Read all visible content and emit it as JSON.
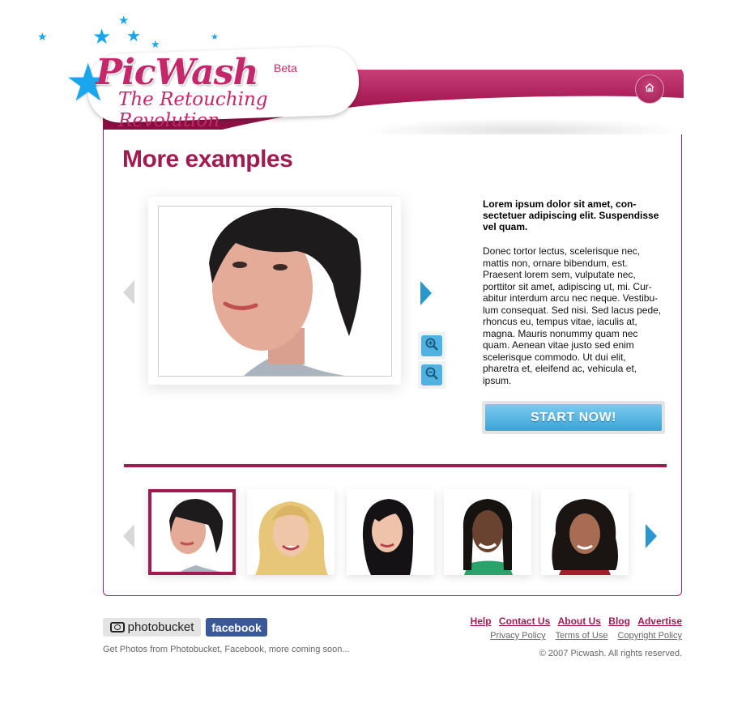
{
  "brand": {
    "name": "PicWash",
    "badge": "Beta",
    "tagline": "The Retouching Revolution",
    "accent_color": "#a01b50",
    "star_color": "#1aa6ea"
  },
  "header": {
    "home_icon": "home-icon"
  },
  "main": {
    "title": "More examples",
    "description_lead": "Lorem ipsum dolor sit amet, con-sectetuer adipiscing elit. Suspendisse vel quam.",
    "description_body": "Donec tortor lectus, scelerisque nec, mattis non, ornare bibendum, est. Praesent lorem sem, vulputate nec, porttitor sit amet, adipiscing ut, mi. Cur-abitur interdum arcu nec neque. Vestibu-lum consequat. Sed nisi. Sed lacus pede, rhoncus eu, tempus vitae, iaculis at, magna. Mauris nonummy quam nec quam. Aenean vitae justo sed enim scelerisque commodo. Ut dui elit, pharetra et, eleifend ac, vehicula et, ipsum.",
    "cta_label": "START NOW!",
    "zoom_in_icon": "zoom-in-icon",
    "zoom_out_icon": "zoom-out-icon"
  },
  "thumbnails": {
    "selected_index": 0,
    "count": 5
  },
  "footer": {
    "photobucket_label": "photobucket",
    "facebook_label": "facebook",
    "note": "Get Photos from Photobucket, Facebook, more coming soon...",
    "nav_links": [
      "Help",
      "Contact Us",
      "About Us",
      "Blog",
      "Advertise"
    ],
    "legal_links": [
      "Privacy Policy",
      "Terms of Use",
      "Copyright Policy"
    ],
    "copyright": "© 2007 Picwash. All rights reserved."
  }
}
